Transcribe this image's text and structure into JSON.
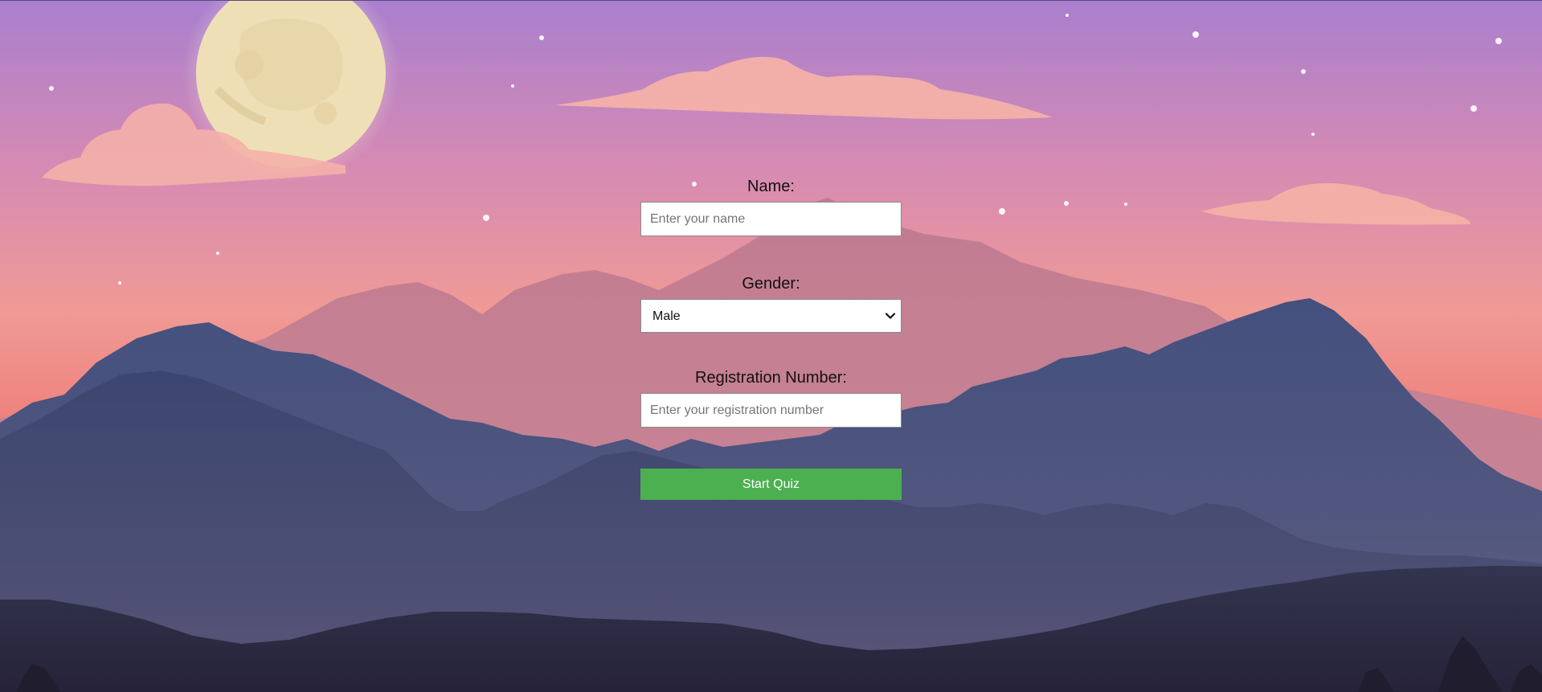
{
  "form": {
    "name_label": "Name:",
    "name_placeholder": "Enter your name",
    "name_value": "",
    "gender_label": "Gender:",
    "gender_selected": "Male",
    "registration_label": "Registration Number:",
    "registration_placeholder": "Enter your registration number",
    "registration_value": "",
    "submit_label": "Start Quiz"
  },
  "colors": {
    "sky_top": "#a97fce",
    "sky_bottom": "#f0877c",
    "submit_button": "#4caf50",
    "moon": "#efdfb6"
  },
  "icons": {
    "dropdown": "chevron-down-icon"
  }
}
